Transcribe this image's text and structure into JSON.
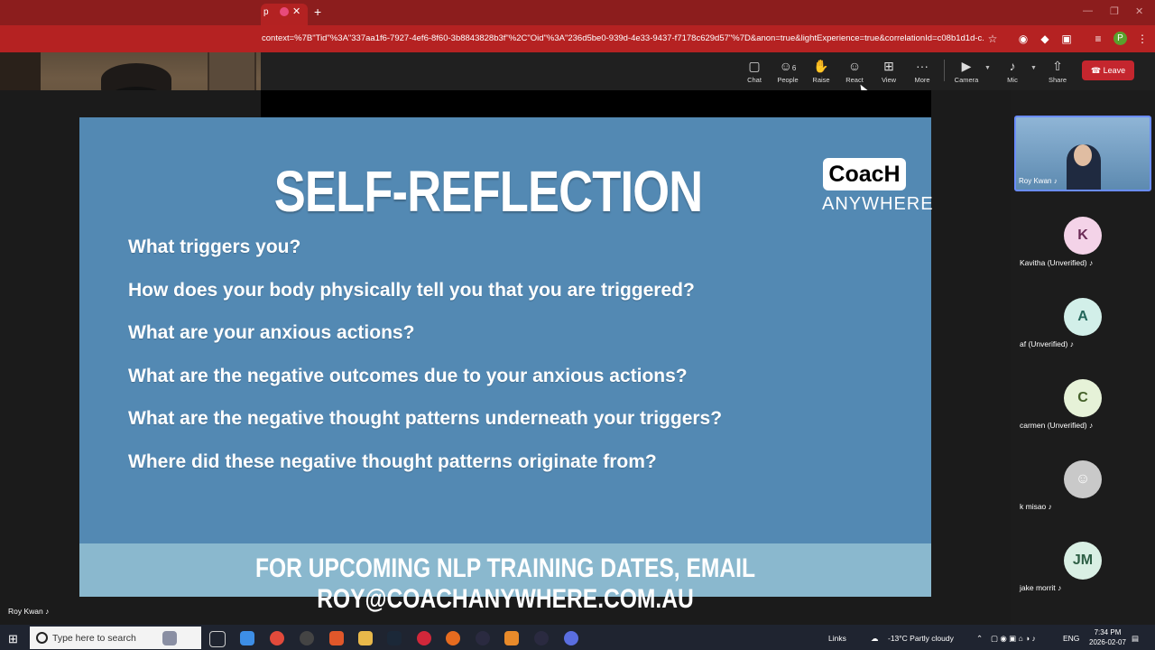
{
  "browser": {
    "tab_label": "p",
    "url": "context=%7B\"Tid\"%3A\"337aa1f6-7927-4ef6-8f60-3b8843828b3f\"%2C\"Oid\"%3A\"236d5be0-939d-4e33-9437-f7178c629d57\"%7D&anon=true&lightExperience=true&correlationId=c08b1d1d-c...",
    "profile_initial": "P"
  },
  "toolbar": {
    "chat": "Chat",
    "people": "People",
    "people_count": "6",
    "raise": "Raise",
    "react": "React",
    "view": "View",
    "more": "More",
    "camera": "Camera",
    "mic": "Mic",
    "share": "Share",
    "leave": "Leave"
  },
  "slide": {
    "title": "SELF-REFLECTION",
    "logo_top": "CoacH",
    "logo_bottom": "ANYWHERE",
    "questions": [
      "What triggers you?",
      "How does your body physically tell you that you are triggered?",
      "What are your anxious actions?",
      "What are the negative outcomes due to your anxious actions?",
      "What are the negative thought patterns underneath your triggers?",
      "Where did these negative thought patterns originate from?"
    ],
    "footer": "FOR UPCOMING NLP TRAINING DATES, EMAIL ROY@COACHANYWHERE.COM.AU"
  },
  "self_video": {
    "name": "Roy Kwan"
  },
  "participants": {
    "featured": {
      "name": "Roy Kwan"
    },
    "list": [
      {
        "initial": "K",
        "name": "Kavitha (Unverified)",
        "color": "#f4d3e8",
        "text_color": "#6b2b56"
      },
      {
        "initial": "A",
        "name": "af (Unverified)",
        "color": "#d2efe9",
        "text_color": "#23665a"
      },
      {
        "initial": "C",
        "name": "carmen (Unverified)",
        "color": "#e6f2d8",
        "text_color": "#45612a"
      },
      {
        "initial": "",
        "name": "k misao",
        "color": "#c9c9c9",
        "text_color": "#ffffff"
      },
      {
        "initial": "JM",
        "name": "jake morrit",
        "color": "#d9efe4",
        "text_color": "#2d5e45"
      }
    ]
  },
  "taskbar": {
    "search_placeholder": "Type here to search",
    "links": "Links",
    "weather": "-13°C  Partly cloudy",
    "lang": "ENG",
    "time": "7:34 PM",
    "date": "2026-02-07"
  }
}
